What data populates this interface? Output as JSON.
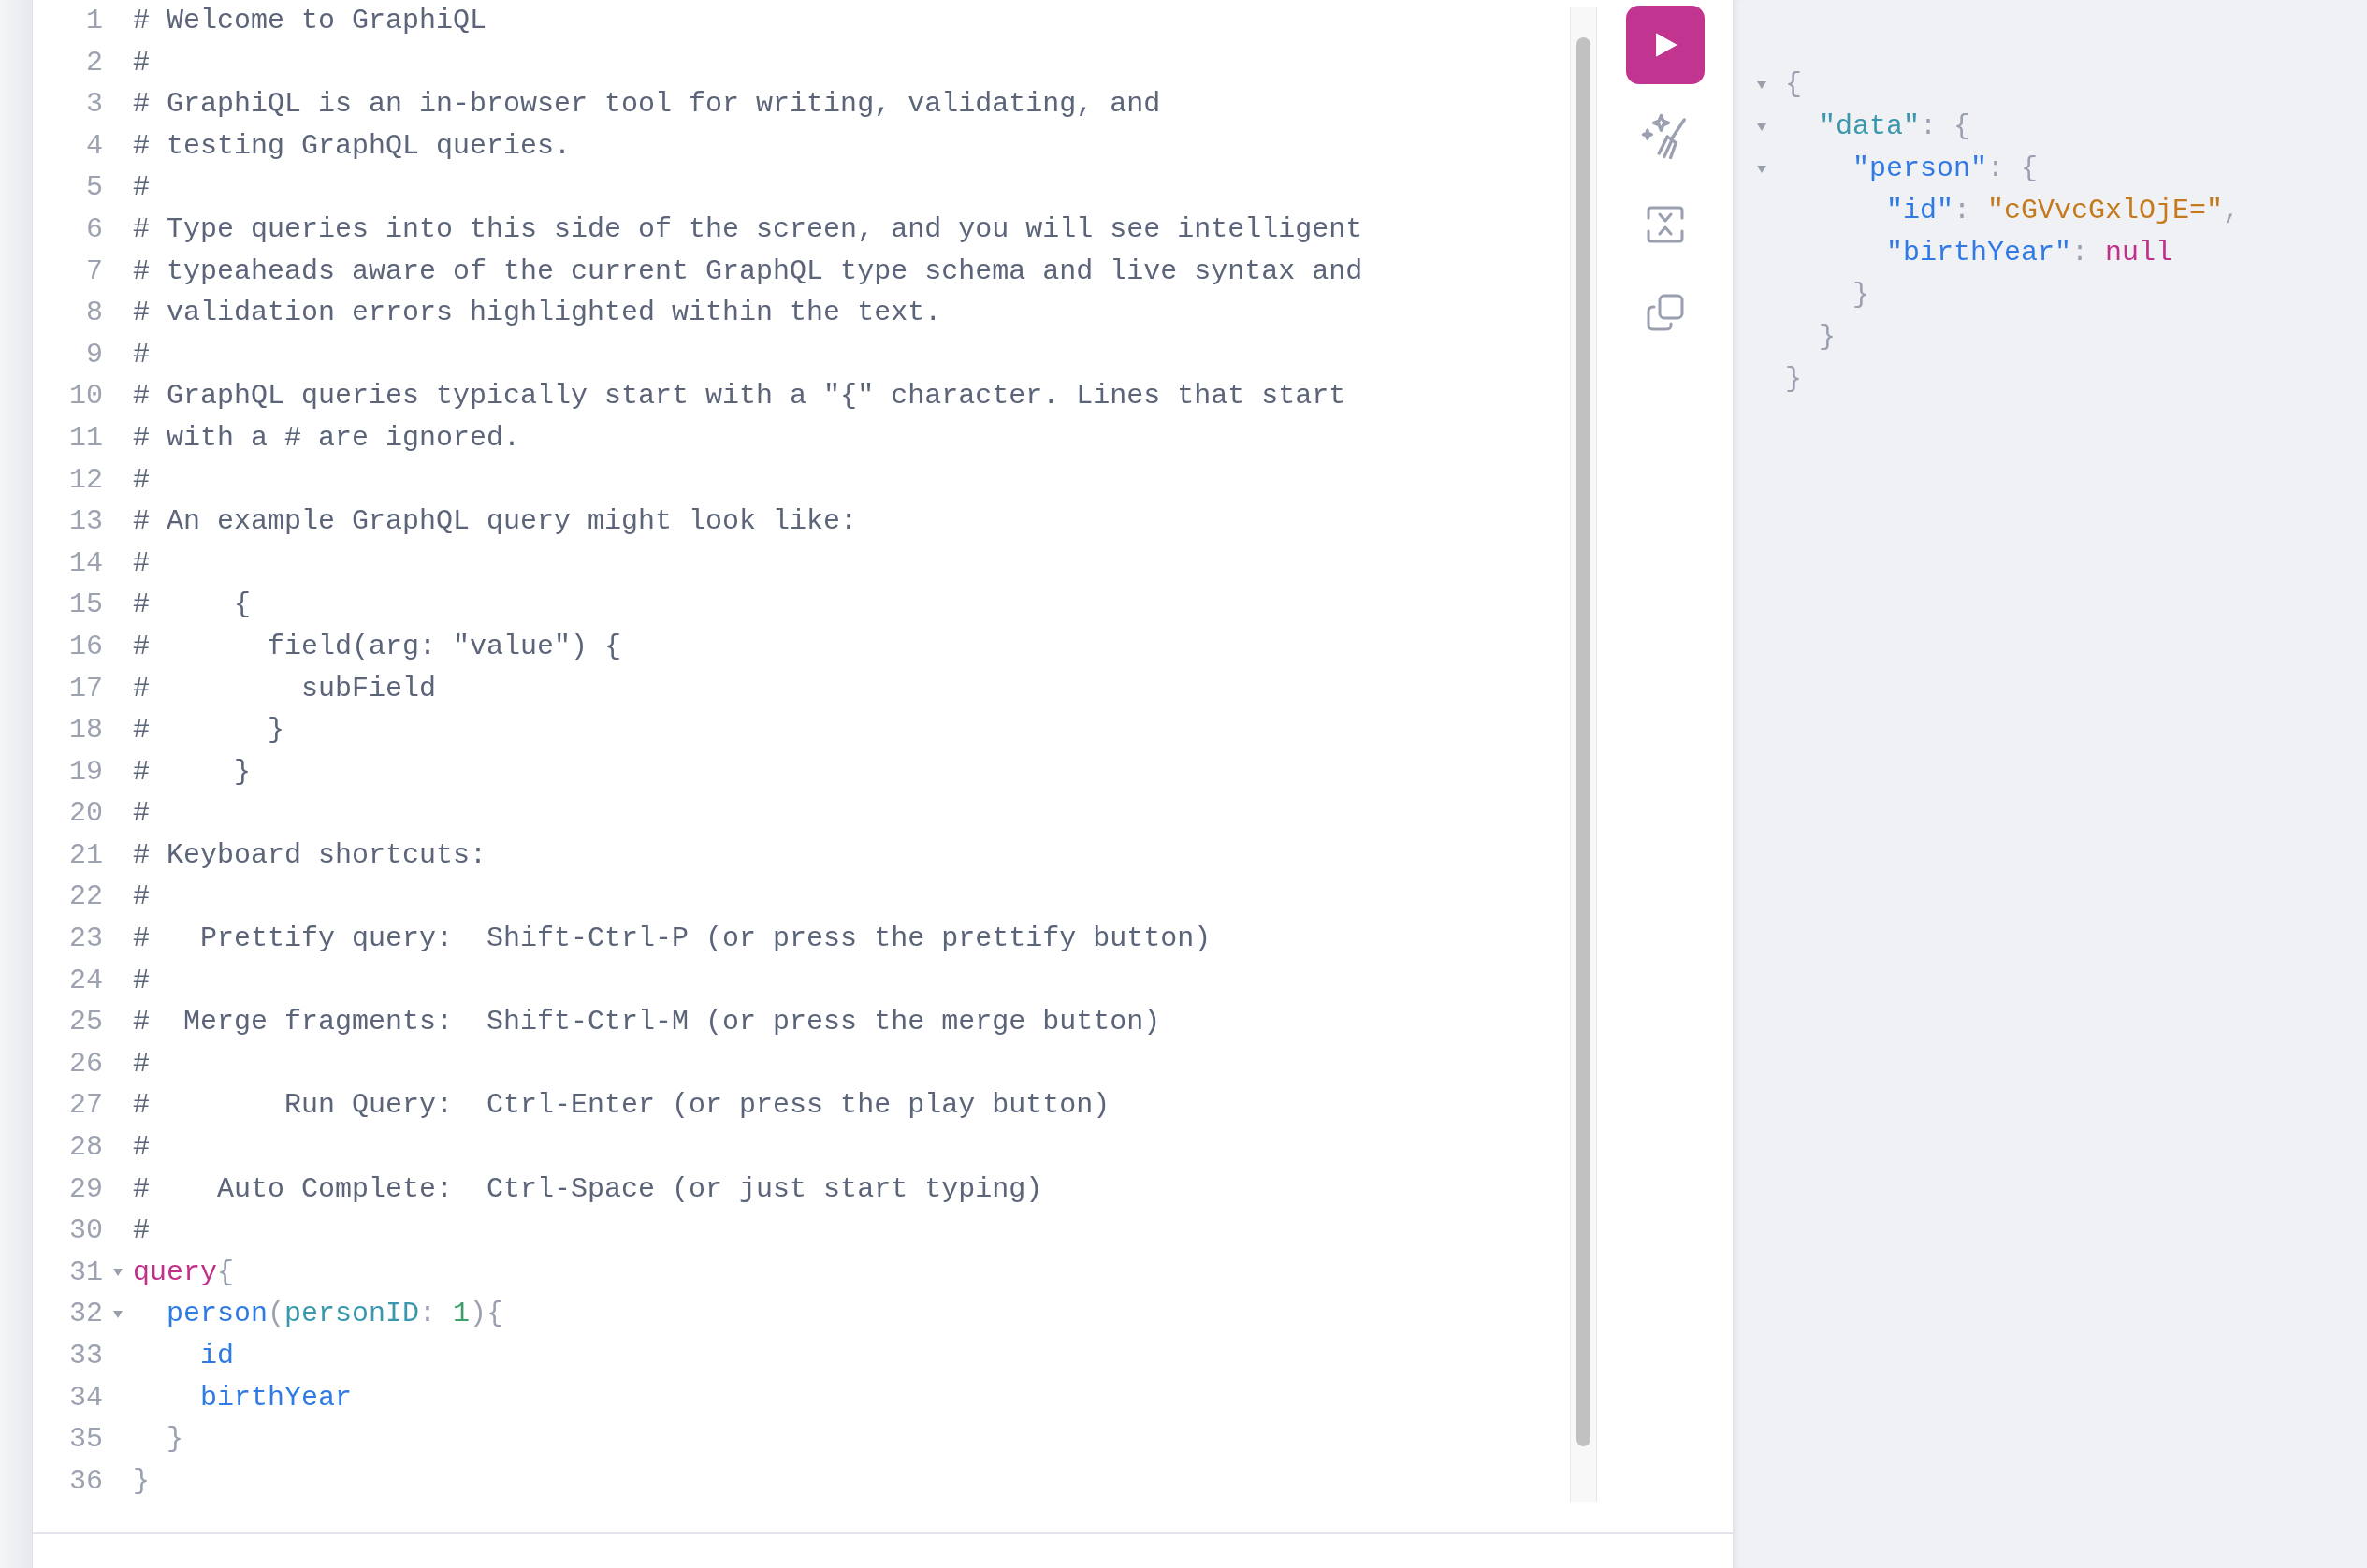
{
  "editor": {
    "lines": [
      {
        "number": "1",
        "tokens": [
          {
            "kind": "comment",
            "text": "# Welcome to GraphiQL"
          }
        ]
      },
      {
        "number": "2",
        "tokens": [
          {
            "kind": "comment",
            "text": "#"
          }
        ]
      },
      {
        "number": "3",
        "tokens": [
          {
            "kind": "comment",
            "text": "# GraphiQL is an in-browser tool for writing, validating, and"
          }
        ]
      },
      {
        "number": "4",
        "tokens": [
          {
            "kind": "comment",
            "text": "# testing GraphQL queries."
          }
        ]
      },
      {
        "number": "5",
        "tokens": [
          {
            "kind": "comment",
            "text": "#"
          }
        ]
      },
      {
        "number": "6",
        "tokens": [
          {
            "kind": "comment",
            "text": "# Type queries into this side of the screen, and you will see intelligent"
          }
        ]
      },
      {
        "number": "7",
        "tokens": [
          {
            "kind": "comment",
            "text": "# typeaheads aware of the current GraphQL type schema and live syntax and"
          }
        ]
      },
      {
        "number": "8",
        "tokens": [
          {
            "kind": "comment",
            "text": "# validation errors highlighted within the text."
          }
        ]
      },
      {
        "number": "9",
        "tokens": [
          {
            "kind": "comment",
            "text": "#"
          }
        ]
      },
      {
        "number": "10",
        "tokens": [
          {
            "kind": "comment",
            "text": "# GraphQL queries typically start with a \"{\" character. Lines that start"
          }
        ]
      },
      {
        "number": "11",
        "tokens": [
          {
            "kind": "comment",
            "text": "# with a # are ignored."
          }
        ]
      },
      {
        "number": "12",
        "tokens": [
          {
            "kind": "comment",
            "text": "#"
          }
        ]
      },
      {
        "number": "13",
        "tokens": [
          {
            "kind": "comment",
            "text": "# An example GraphQL query might look like:"
          }
        ]
      },
      {
        "number": "14",
        "tokens": [
          {
            "kind": "comment",
            "text": "#"
          }
        ]
      },
      {
        "number": "15",
        "tokens": [
          {
            "kind": "comment",
            "text": "#     {"
          }
        ]
      },
      {
        "number": "16",
        "tokens": [
          {
            "kind": "comment",
            "text": "#       field(arg: \"value\") {"
          }
        ]
      },
      {
        "number": "17",
        "tokens": [
          {
            "kind": "comment",
            "text": "#         subField"
          }
        ]
      },
      {
        "number": "18",
        "tokens": [
          {
            "kind": "comment",
            "text": "#       }"
          }
        ]
      },
      {
        "number": "19",
        "tokens": [
          {
            "kind": "comment",
            "text": "#     }"
          }
        ]
      },
      {
        "number": "20",
        "tokens": [
          {
            "kind": "comment",
            "text": "#"
          }
        ]
      },
      {
        "number": "21",
        "tokens": [
          {
            "kind": "comment",
            "text": "# Keyboard shortcuts:"
          }
        ]
      },
      {
        "number": "22",
        "tokens": [
          {
            "kind": "comment",
            "text": "#"
          }
        ]
      },
      {
        "number": "23",
        "tokens": [
          {
            "kind": "comment",
            "text": "#   Prettify query:  Shift-Ctrl-P (or press the prettify button)"
          }
        ]
      },
      {
        "number": "24",
        "tokens": [
          {
            "kind": "comment",
            "text": "#"
          }
        ]
      },
      {
        "number": "25",
        "tokens": [
          {
            "kind": "comment",
            "text": "#  Merge fragments:  Shift-Ctrl-M (or press the merge button)"
          }
        ]
      },
      {
        "number": "26",
        "tokens": [
          {
            "kind": "comment",
            "text": "#"
          }
        ]
      },
      {
        "number": "27",
        "tokens": [
          {
            "kind": "comment",
            "text": "#        Run Query:  Ctrl-Enter (or press the play button)"
          }
        ]
      },
      {
        "number": "28",
        "tokens": [
          {
            "kind": "comment",
            "text": "#"
          }
        ]
      },
      {
        "number": "29",
        "tokens": [
          {
            "kind": "comment",
            "text": "#    Auto Complete:  Ctrl-Space (or just start typing)"
          }
        ]
      },
      {
        "number": "30",
        "tokens": [
          {
            "kind": "comment",
            "text": "#"
          }
        ]
      },
      {
        "number": "31",
        "expanded": true,
        "tokens": [
          {
            "kind": "keyword",
            "text": "query"
          },
          {
            "kind": "punctuation",
            "text": "{"
          }
        ]
      },
      {
        "number": "32",
        "expanded": true,
        "tokens": [
          {
            "kind": "property",
            "text": "  person"
          },
          {
            "kind": "punctuation",
            "text": "("
          },
          {
            "kind": "def",
            "text": "personID"
          },
          {
            "kind": "punctuation",
            "text": ": "
          },
          {
            "kind": "number",
            "text": "1"
          },
          {
            "kind": "punctuation",
            "text": "){"
          }
        ]
      },
      {
        "number": "33",
        "tokens": [
          {
            "kind": "property",
            "text": "    id"
          }
        ]
      },
      {
        "number": "34",
        "tokens": [
          {
            "kind": "property",
            "text": "    birthYear"
          }
        ]
      },
      {
        "number": "35",
        "tokens": [
          {
            "kind": "punctuation",
            "text": "  }"
          }
        ]
      },
      {
        "number": "36",
        "tokens": [
          {
            "kind": "punctuation",
            "text": "}"
          }
        ]
      }
    ]
  },
  "response": {
    "lines": [
      {
        "expanded": true,
        "tokens": [
          {
            "kind": "punctuation",
            "text": "{"
          }
        ]
      },
      {
        "expanded": true,
        "tokens": [
          {
            "kind": "def",
            "text": "  \"data\""
          },
          {
            "kind": "punctuation",
            "text": ": {"
          }
        ]
      },
      {
        "expanded": true,
        "tokens": [
          {
            "kind": "property",
            "text": "    \"person\""
          },
          {
            "kind": "punctuation",
            "text": ": {"
          }
        ]
      },
      {
        "tokens": [
          {
            "kind": "property",
            "text": "      \"id\""
          },
          {
            "kind": "punctuation",
            "text": ": "
          },
          {
            "kind": "string",
            "text": "\"cGVvcGxlOjE=\""
          },
          {
            "kind": "punctuation",
            "text": ","
          }
        ]
      },
      {
        "tokens": [
          {
            "kind": "property",
            "text": "      \"birthYear\""
          },
          {
            "kind": "punctuation",
            "text": ": "
          },
          {
            "kind": "keyword",
            "text": "null"
          }
        ]
      },
      {
        "tokens": [
          {
            "kind": "punctuation",
            "text": "    }"
          }
        ]
      },
      {
        "tokens": [
          {
            "kind": "punctuation",
            "text": "  }"
          }
        ]
      },
      {
        "tokens": [
          {
            "kind": "punctuation",
            "text": "}"
          }
        ]
      }
    ]
  }
}
